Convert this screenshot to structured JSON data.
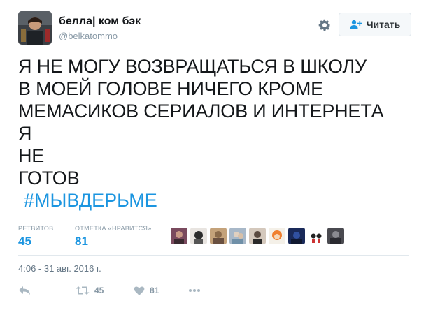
{
  "user": {
    "display_name": "белла| ком бэк",
    "username": "@belkatommo"
  },
  "header": {
    "settings_icon": "gear-icon",
    "follow_label": "Читать",
    "follow_icon": "add-user-icon"
  },
  "tweet": {
    "lines": [
      "Я НЕ МОГУ ВОЗВРАЩАТЬСЯ В ШКОЛУ",
      "В МОЕЙ ГОЛОВЕ НИЧЕГО КРОМЕ",
      "МЕМАСИКОВ СЕРИАЛОВ И ИНТЕРНЕТА",
      "Я",
      "НЕ",
      "ГОТОВ"
    ],
    "hashtag": "#МЫВДЕРЬМЕ"
  },
  "stats": {
    "retweets_label": "РЕТВИТОВ",
    "retweets_count": "45",
    "likes_label": "ОТМЕТКА «НРАВИТСЯ»",
    "likes_count": "81"
  },
  "timestamp": "4:06 - 31 авг. 2016 г.",
  "actions": {
    "reply_icon": "reply-icon",
    "retweet_icon": "retweet-icon",
    "retweet_count": "45",
    "like_icon": "heart-icon",
    "like_count": "81",
    "more_icon": "more-icon"
  },
  "colors": {
    "accent": "#1b95e0",
    "muted": "#8899a6",
    "text": "#14171a",
    "border": "#e1e8ed"
  }
}
